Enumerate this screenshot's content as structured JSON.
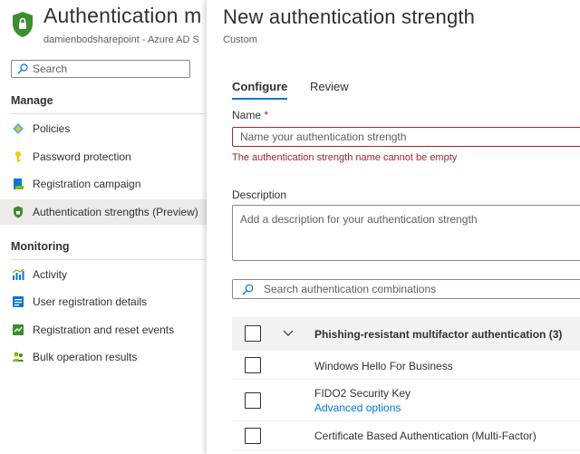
{
  "left": {
    "title": "Authentication m",
    "subtitle": "damienbodsharepoint - Azure AD S",
    "search_placeholder": "Search",
    "sections": {
      "manage": "Manage",
      "monitoring": "Monitoring"
    },
    "manage_items": [
      {
        "label": "Policies",
        "icon": "policies-icon"
      },
      {
        "label": "Password protection",
        "icon": "key-icon"
      },
      {
        "label": "Registration campaign",
        "icon": "registration-icon"
      },
      {
        "label": "Authentication strengths (Preview)",
        "icon": "shield-icon",
        "selected": true
      }
    ],
    "monitoring_items": [
      {
        "label": "Activity",
        "icon": "activity-chart-icon"
      },
      {
        "label": "User registration details",
        "icon": "user-details-icon"
      },
      {
        "label": "Registration and reset events",
        "icon": "events-icon"
      },
      {
        "label": "Bulk operation results",
        "icon": "people-icon"
      }
    ]
  },
  "blade": {
    "title": "New authentication strength",
    "subtitle": "Custom",
    "tabs": [
      {
        "label": "Configure",
        "active": true
      },
      {
        "label": "Review",
        "active": false
      }
    ],
    "name": {
      "label": "Name",
      "required_marker": "*",
      "placeholder": "Name your authentication strength",
      "error": "The authentication strength name cannot be empty"
    },
    "description": {
      "label": "Description",
      "placeholder": "Add a description for your authentication strength"
    },
    "combinations_search_placeholder": "Search authentication combinations",
    "group": {
      "label": "Phishing-resistant multifactor authentication (3)"
    },
    "rows": [
      {
        "label": "Windows Hello For Business"
      },
      {
        "label": "FIDO2 Security Key",
        "link": "Advanced options"
      },
      {
        "label": "Certificate Based Authentication (Multi-Factor)"
      }
    ]
  },
  "colors": {
    "accent": "#0078d4",
    "error": "#a4262c",
    "shield_green": "#3c8d2f"
  }
}
